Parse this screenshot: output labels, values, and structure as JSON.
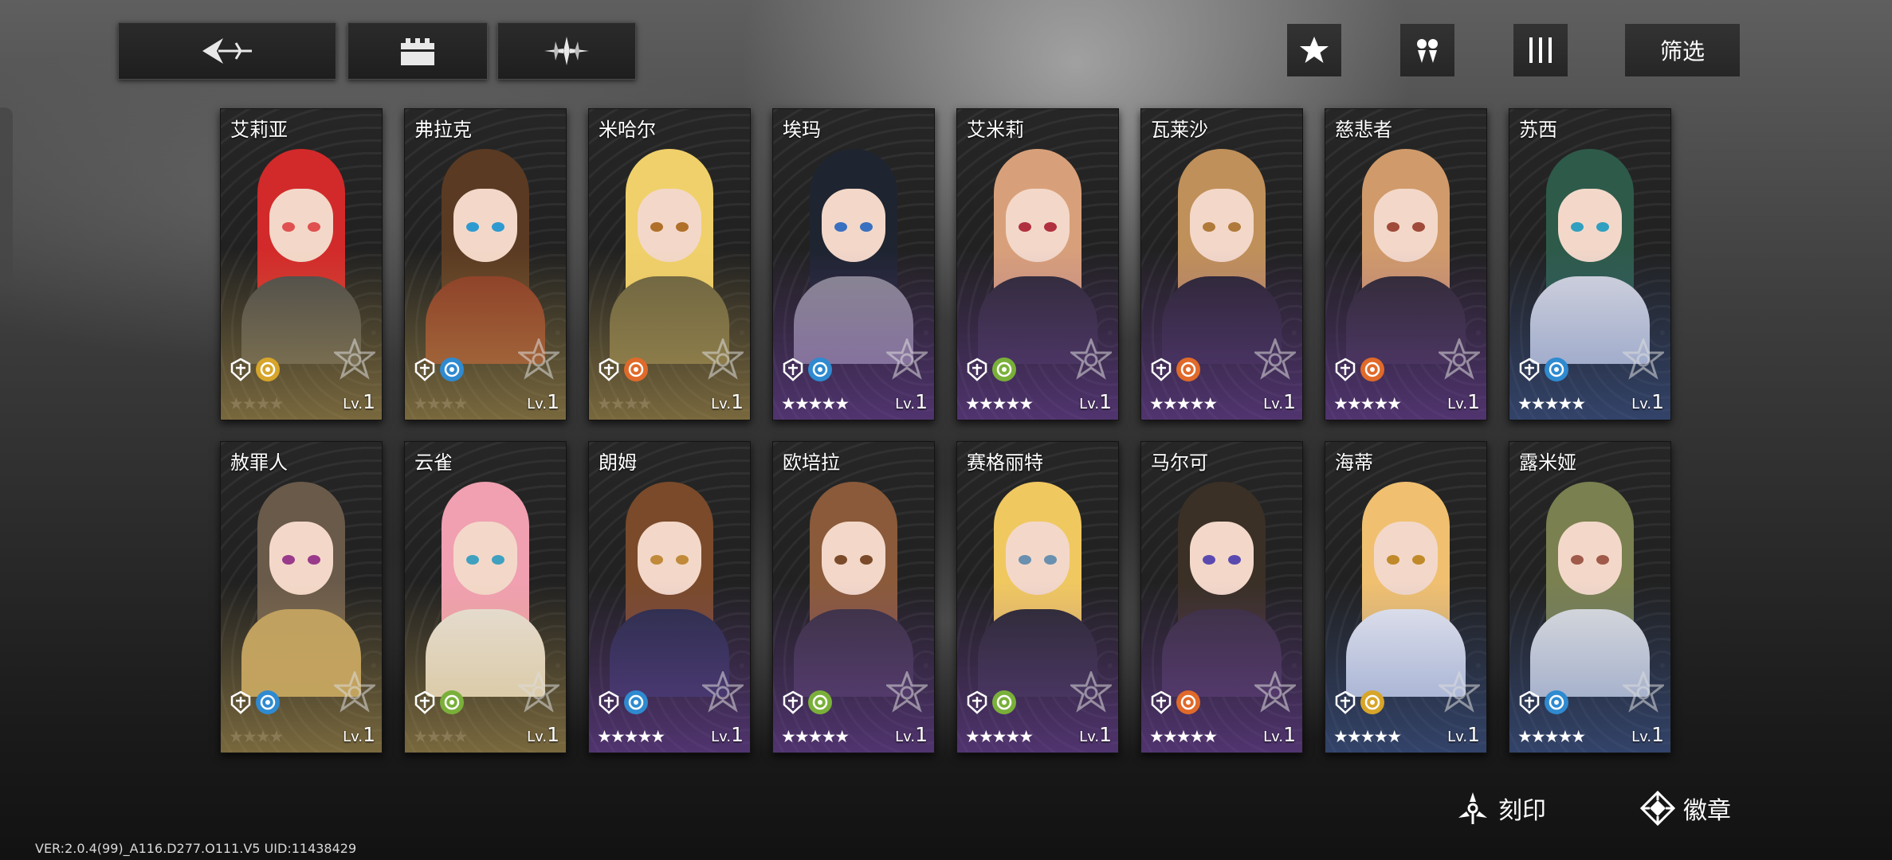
{
  "toolbar": {
    "back_icon": "back-arrow-icon",
    "castle_icon": "castle-icon",
    "spark_icon": "spark-icon",
    "star_icon": "star-icon",
    "group_icon": "group-icon",
    "columns_icon": "columns-icon",
    "filter_label": "筛选"
  },
  "characters": [
    {
      "name": "艾莉亚",
      "stars": "★★★★",
      "level_prefix": "Lv.",
      "level": "1",
      "tint": "gold",
      "hair": "#d22a2a",
      "eye": "#e05050",
      "outfit": "#4a4a4a",
      "element": "#d7a52a"
    },
    {
      "name": "弗拉克",
      "stars": "★★★★",
      "level_prefix": "Lv.",
      "level": "1",
      "tint": "gold",
      "hair": "#5a3a22",
      "eye": "#2f9ad0",
      "outfit": "#8a3a25",
      "element": "#2f8ad0"
    },
    {
      "name": "米哈尔",
      "stars": "★★★★",
      "level_prefix": "Lv.",
      "level": "1",
      "tint": "gold",
      "hair": "#f0d06a",
      "eye": "#b0702a",
      "outfit": "#6a6240",
      "element": "#e06a2a"
    },
    {
      "name": "埃玛",
      "stars": "★★★★★",
      "level_prefix": "Lv.",
      "level": "1",
      "tint": "purple",
      "hair": "#1e2430",
      "eye": "#3a70c0",
      "outfit": "#8a8a90",
      "element": "#2f8ad0"
    },
    {
      "name": "艾米莉",
      "stars": "★★★★★",
      "level_prefix": "Lv.",
      "level": "1",
      "tint": "purple",
      "hair": "#d8a07a",
      "eye": "#b03040",
      "outfit": "#2e2a34",
      "element": "#7ab03a"
    },
    {
      "name": "瓦莱沙",
      "stars": "★★★★★",
      "level_prefix": "Lv.",
      "level": "1",
      "tint": "purple",
      "hair": "#c0905a",
      "eye": "#b07a3a",
      "outfit": "#2a2630",
      "element": "#e06a2a"
    },
    {
      "name": "慈悲者",
      "stars": "★★★★★",
      "level_prefix": "Lv.",
      "level": "1",
      "tint": "purple",
      "hair": "#d09a6a",
      "eye": "#a04a3a",
      "outfit": "#2e2a30",
      "element": "#e06a2a"
    },
    {
      "name": "苏西",
      "stars": "★★★★★",
      "level_prefix": "Lv.",
      "level": "1",
      "tint": "blue",
      "hair": "#2e5a4a",
      "eye": "#30a0c0",
      "outfit": "#d8d8e0",
      "element": "#2f8ad0"
    },
    {
      "name": "赦罪人",
      "stars": "★★★★",
      "level_prefix": "Lv.",
      "level": "1",
      "tint": "gold",
      "hair": "#6a5a4a",
      "eye": "#9a3a8a",
      "outfit": "#c0a060",
      "element": "#2f8ad0"
    },
    {
      "name": "云雀",
      "stars": "★★★★",
      "level_prefix": "Lv.",
      "level": "1",
      "tint": "gold",
      "hair": "#f0a0b0",
      "eye": "#40a0c0",
      "outfit": "#e8e0d8",
      "element": "#7ab03a"
    },
    {
      "name": "朗姆",
      "stars": "★★★★★",
      "level_prefix": "Lv.",
      "level": "1",
      "tint": "purple",
      "hair": "#7a4a2a",
      "eye": "#c08a3a",
      "outfit": "#2a2e48",
      "element": "#2f8ad0"
    },
    {
      "name": "欧培拉",
      "stars": "★★★★★",
      "level_prefix": "Lv.",
      "level": "1",
      "tint": "purple",
      "hair": "#8a5a3a",
      "eye": "#7a4a2a",
      "outfit": "#3a3240",
      "element": "#7ab03a"
    },
    {
      "name": "赛格丽特",
      "stars": "★★★★★",
      "level_prefix": "Lv.",
      "level": "1",
      "tint": "purple",
      "hair": "#f0c860",
      "eye": "#6a90b0",
      "outfit": "#2a2a30",
      "element": "#7ab03a"
    },
    {
      "name": "马尔可",
      "stars": "★★★★★",
      "level_prefix": "Lv.",
      "level": "1",
      "tint": "purple",
      "hair": "#3a3026",
      "eye": "#5a4ab0",
      "outfit": "#3a3040",
      "element": "#e06a2a"
    },
    {
      "name": "海蒂",
      "stars": "★★★★★",
      "level_prefix": "Lv.",
      "level": "1",
      "tint": "blue",
      "hair": "#f0c070",
      "eye": "#c08a2a",
      "outfit": "#e8e8f0",
      "element": "#d7a52a"
    },
    {
      "name": "露米娅",
      "stars": "★★★★★",
      "level_prefix": "Lv.",
      "level": "1",
      "tint": "blue",
      "hair": "#7a8050",
      "eye": "#a05a4a",
      "outfit": "#e0e0e0",
      "element": "#2f8ad0"
    }
  ],
  "bottom": {
    "engrave_label": "刻印",
    "engrave_icon": "engrave-icon",
    "badge_label": "徽章",
    "badge_icon": "badge-icon"
  },
  "footer": {
    "version": "VER:2.0.4(99)_A116.D277.O111.V5    UID:11438429"
  },
  "colors": {
    "gold_tint": "#c6a85a",
    "purple_tint": "#7c48b4",
    "blue_tint": "#4664aa"
  }
}
